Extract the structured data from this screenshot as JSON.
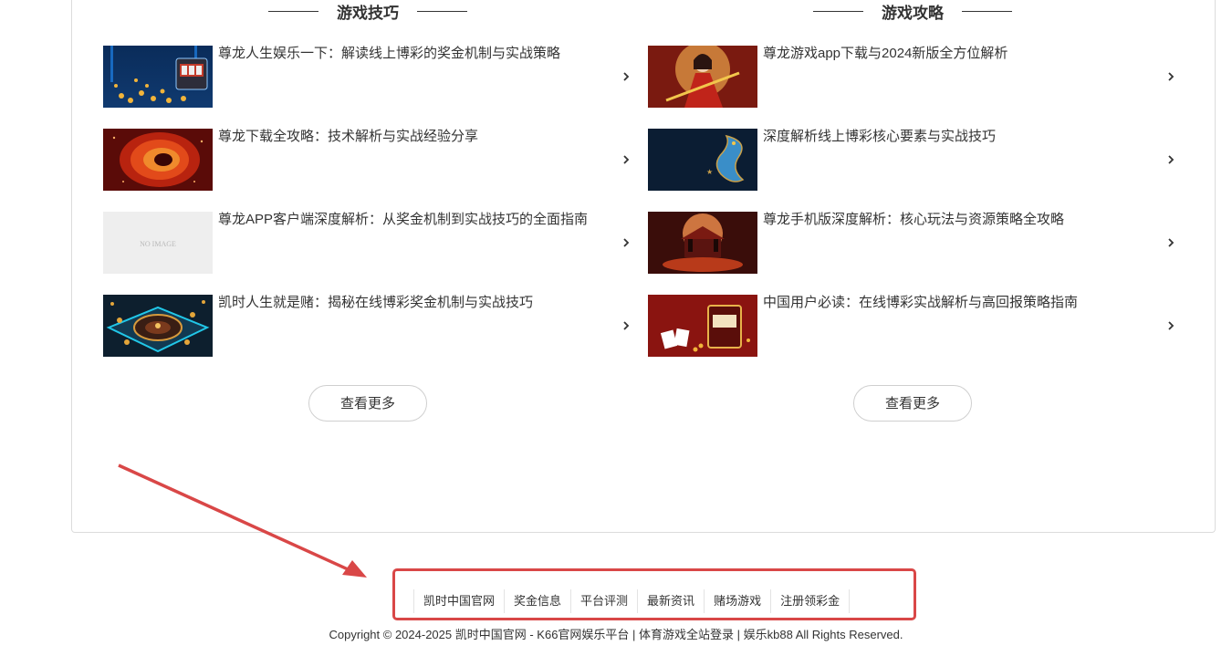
{
  "sections": {
    "tips": {
      "title": "游戏技巧",
      "items": [
        {
          "title": "尊龙人生娱乐一下：解读线上博彩的奖金机制与实战策略",
          "image": "slot-machine-coins"
        },
        {
          "title": "尊龙下载全攻略：技术解析与实战经验分享",
          "image": "red-vortex"
        },
        {
          "title": "尊龙APP客户端深度解析：从奖金机制到实战技巧的全面指南",
          "image": "no-image",
          "placeholder_text": "NO IMAGE"
        },
        {
          "title": "凯时人生就是赌：揭秘在线博彩奖金机制与实战技巧",
          "image": "roulette-table"
        }
      ],
      "more_label": "查看更多"
    },
    "guides": {
      "title": "游戏攻略",
      "items": [
        {
          "title": "尊龙游戏app下载与2024新版全方位解析",
          "image": "warrior-woman"
        },
        {
          "title": "深度解析线上博彩核心要素与实战技巧",
          "image": "blue-dragon"
        },
        {
          "title": "尊龙手机版深度解析：核心玩法与资源策略全攻略",
          "image": "red-palace"
        },
        {
          "title": "中国用户必读：在线博彩实战解析与高回报策略指南",
          "image": "red-slot-cards"
        }
      ],
      "more_label": "查看更多"
    }
  },
  "footer": {
    "links": [
      "凯时中国官网",
      "奖金信息",
      "平台评测",
      "最新资讯",
      "赌场游戏",
      "注册领彩金"
    ],
    "copyright": "Copyright © 2024-2025 凯时中国官网 - K66官网娱乐平台 | 体育游戏全站登录 | 娱乐kb88 All Rights Reserved."
  },
  "colors": {
    "highlight": "#d94747",
    "border": "#dcdcdc",
    "text": "#333333"
  }
}
